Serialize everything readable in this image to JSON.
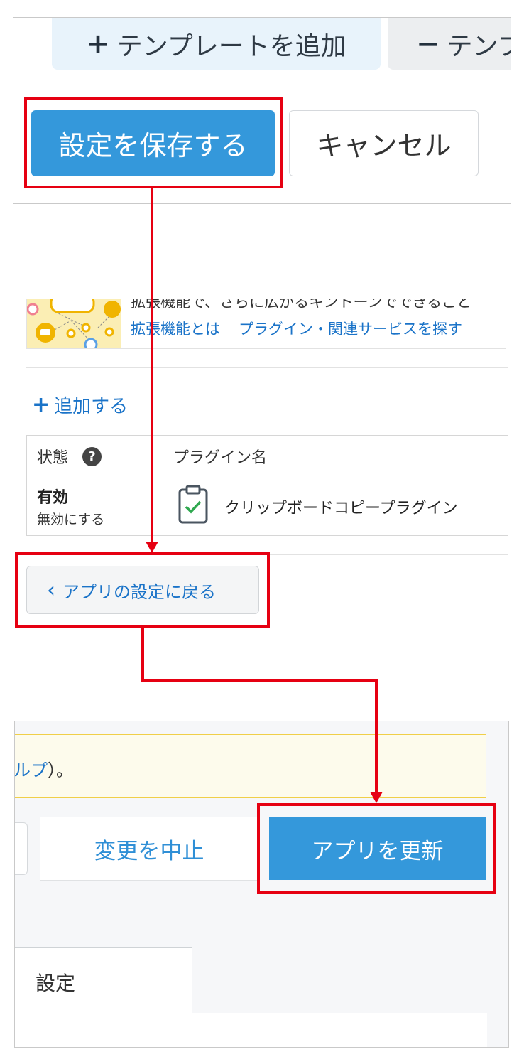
{
  "panel1": {
    "add_template": {
      "icon": "plus-icon",
      "label": "テンプレートを追加"
    },
    "remove_template": {
      "icon": "minus-icon",
      "label": "テンプ"
    },
    "save_button": "設定を保存する",
    "cancel_button": "キャンセル"
  },
  "panel2": {
    "banner": {
      "cut_text": "拡張機能で、さらに広がるキントーンでできること",
      "link_about": "拡張機能とは",
      "link_search": "プラグイン・関連サービスを探す"
    },
    "add_button": "追加する",
    "table": {
      "headers": {
        "status": "状態",
        "name": "プラグイン名"
      },
      "help_icon": "?",
      "rows": [
        {
          "status": "有効",
          "action": "無効にする",
          "icon": "clipboard-check-icon",
          "name": "クリップボードコピープラグイン"
        }
      ]
    },
    "back_button": {
      "icon": "chevron-left-icon",
      "label": "アプリの設定に戻る"
    }
  },
  "panel3": {
    "notice": {
      "link_fragment": "ルプ",
      "suffix": "）。"
    },
    "discard_button": "変更を中止",
    "update_button": "アプリを更新",
    "settings_tab": "設定"
  },
  "colors": {
    "primary": "#3498db",
    "link": "#1a73c8",
    "highlight": "#e60012",
    "notice_bg": "#fdfbec",
    "notice_border": "#f0cf48"
  }
}
